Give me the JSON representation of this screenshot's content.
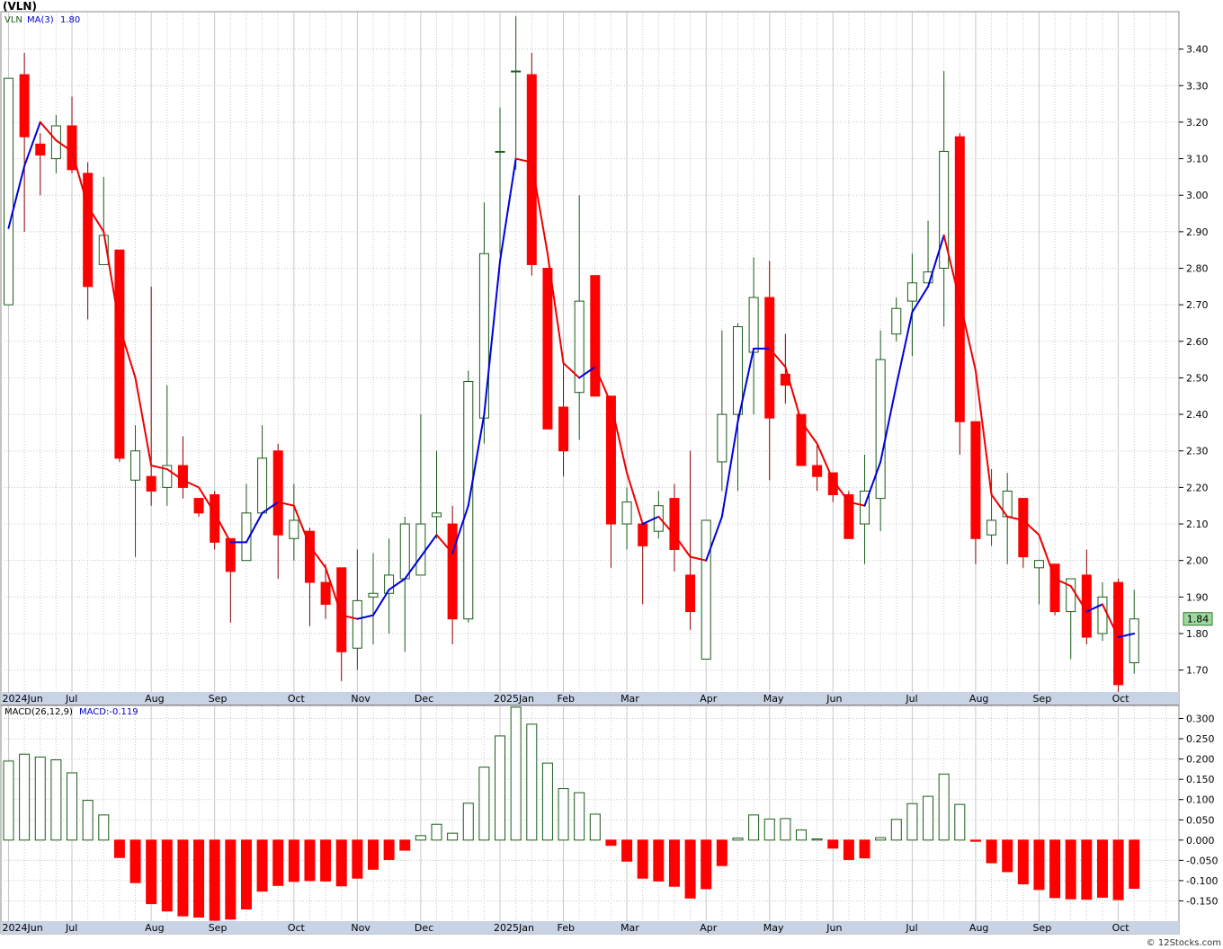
{
  "page": {
    "symbol": "(VLN)",
    "watermark": "© 12Stocks.com"
  },
  "colors": {
    "up": "#1a5c1a",
    "down": "#ff0000",
    "ma_up": "#0000dd",
    "ma_down": "#ee0000",
    "grid": "#c8c8c8",
    "axis_band": "#c8d3e6",
    "price_tag_bg": "#9fd89f"
  },
  "chart_data": [
    {
      "type": "candlestick",
      "legend": {
        "symbol": "VLN",
        "ma_label": "MA(3)",
        "ma_value": "1.80"
      },
      "ylim": [
        1.64,
        3.5
      ],
      "y_ticks": [
        1.7,
        1.8,
        1.9,
        2.0,
        2.1,
        2.2,
        2.3,
        2.4,
        2.5,
        2.6,
        2.7,
        2.8,
        2.9,
        3.0,
        3.1,
        3.2,
        3.3,
        3.4
      ],
      "y_tick_labels": [
        "1.70",
        "1.80",
        "1.90",
        "2.00",
        "2.10",
        "2.20",
        "2.30",
        "2.40",
        "2.50",
        "2.60",
        "2.70",
        "2.80",
        "2.90",
        "3.00",
        "3.10",
        "3.20",
        "3.30",
        "3.40"
      ],
      "last_price_label": "1.84",
      "last_price": 1.84,
      "x_labels": [
        {
          "label": "2024Jun",
          "week": 0
        },
        {
          "label": "Jul",
          "week": 4
        },
        {
          "label": "Aug",
          "week": 9
        },
        {
          "label": "Sep",
          "week": 13
        },
        {
          "label": "Oct",
          "week": 18
        },
        {
          "label": "Nov",
          "week": 22
        },
        {
          "label": "Dec",
          "week": 26
        },
        {
          "label": "2025Jan",
          "week": 31
        },
        {
          "label": "Feb",
          "week": 35
        },
        {
          "label": "Mar",
          "week": 39
        },
        {
          "label": "Apr",
          "week": 44
        },
        {
          "label": "May",
          "week": 48
        },
        {
          "label": "Jun",
          "week": 52
        },
        {
          "label": "Jul",
          "week": 57
        },
        {
          "label": "Aug",
          "week": 61
        },
        {
          "label": "Sep",
          "week": 65
        },
        {
          "label": "Oct",
          "week": 70
        }
      ],
      "candles": [
        {
          "o": 2.7,
          "h": 3.32,
          "l": 2.7,
          "c": 3.32
        },
        {
          "o": 3.33,
          "h": 3.39,
          "l": 2.9,
          "c": 3.16
        },
        {
          "o": 3.14,
          "h": 3.17,
          "l": 3.0,
          "c": 3.11
        },
        {
          "o": 3.1,
          "h": 3.22,
          "l": 3.06,
          "c": 3.19
        },
        {
          "o": 3.19,
          "h": 3.27,
          "l": 3.06,
          "c": 3.07
        },
        {
          "o": 3.06,
          "h": 3.09,
          "l": 2.66,
          "c": 2.75
        },
        {
          "o": 2.81,
          "h": 3.05,
          "l": 2.81,
          "c": 2.89
        },
        {
          "o": 2.85,
          "h": 2.85,
          "l": 2.27,
          "c": 2.28
        },
        {
          "o": 2.22,
          "h": 2.37,
          "l": 2.01,
          "c": 2.3
        },
        {
          "o": 2.23,
          "h": 2.75,
          "l": 2.15,
          "c": 2.19
        },
        {
          "o": 2.2,
          "h": 2.48,
          "l": 2.15,
          "c": 2.26
        },
        {
          "o": 2.26,
          "h": 2.34,
          "l": 2.17,
          "c": 2.2
        },
        {
          "o": 2.17,
          "h": 2.17,
          "l": 2.12,
          "c": 2.13
        },
        {
          "o": 2.18,
          "h": 2.19,
          "l": 2.03,
          "c": 2.05
        },
        {
          "o": 2.06,
          "h": 2.06,
          "l": 1.83,
          "c": 1.97
        },
        {
          "o": 2.0,
          "h": 2.21,
          "l": 2.0,
          "c": 2.13
        },
        {
          "o": 2.13,
          "h": 2.37,
          "l": 2.13,
          "c": 2.28
        },
        {
          "o": 2.3,
          "h": 2.32,
          "l": 1.95,
          "c": 2.07
        },
        {
          "o": 2.06,
          "h": 2.21,
          "l": 2.0,
          "c": 2.11
        },
        {
          "o": 2.08,
          "h": 2.09,
          "l": 1.82,
          "c": 1.94
        },
        {
          "o": 1.94,
          "h": 1.99,
          "l": 1.84,
          "c": 1.88
        },
        {
          "o": 1.98,
          "h": 1.98,
          "l": 1.67,
          "c": 1.75
        },
        {
          "o": 1.76,
          "h": 2.03,
          "l": 1.7,
          "c": 1.89
        },
        {
          "o": 1.9,
          "h": 2.02,
          "l": 1.77,
          "c": 1.91
        },
        {
          "o": 1.91,
          "h": 2.06,
          "l": 1.8,
          "c": 1.96
        },
        {
          "o": 1.95,
          "h": 2.12,
          "l": 1.75,
          "c": 2.1
        },
        {
          "o": 1.96,
          "h": 2.4,
          "l": 1.96,
          "c": 2.1
        },
        {
          "o": 2.12,
          "h": 2.3,
          "l": 2.06,
          "c": 2.13
        },
        {
          "o": 2.1,
          "h": 2.15,
          "l": 1.77,
          "c": 1.84
        },
        {
          "o": 1.84,
          "h": 2.52,
          "l": 1.83,
          "c": 2.49
        },
        {
          "o": 2.39,
          "h": 2.98,
          "l": 2.32,
          "c": 2.84
        },
        {
          "o": 3.12,
          "h": 3.24,
          "l": 2.84,
          "c": 3.12
        },
        {
          "o": 3.34,
          "h": 3.49,
          "l": 3.07,
          "c": 3.34
        },
        {
          "o": 3.33,
          "h": 3.39,
          "l": 2.78,
          "c": 2.81
        },
        {
          "o": 2.8,
          "h": 2.8,
          "l": 2.36,
          "c": 2.36
        },
        {
          "o": 2.42,
          "h": 2.54,
          "l": 2.23,
          "c": 2.3
        },
        {
          "o": 2.46,
          "h": 3.0,
          "l": 2.33,
          "c": 2.71
        },
        {
          "o": 2.78,
          "h": 2.78,
          "l": 2.45,
          "c": 2.45
        },
        {
          "o": 2.45,
          "h": 2.45,
          "l": 1.98,
          "c": 2.1
        },
        {
          "o": 2.1,
          "h": 2.2,
          "l": 2.03,
          "c": 2.16
        },
        {
          "o": 2.1,
          "h": 2.1,
          "l": 1.88,
          "c": 2.04
        },
        {
          "o": 2.08,
          "h": 2.19,
          "l": 2.06,
          "c": 2.15
        },
        {
          "o": 2.17,
          "h": 2.21,
          "l": 1.97,
          "c": 2.03
        },
        {
          "o": 1.96,
          "h": 2.3,
          "l": 1.81,
          "c": 1.86
        },
        {
          "o": 1.73,
          "h": 2.11,
          "l": 1.73,
          "c": 2.11
        },
        {
          "o": 2.27,
          "h": 2.63,
          "l": 2.19,
          "c": 2.4
        },
        {
          "o": 2.4,
          "h": 2.65,
          "l": 2.19,
          "c": 2.64
        },
        {
          "o": 2.57,
          "h": 2.83,
          "l": 2.4,
          "c": 2.72
        },
        {
          "o": 2.72,
          "h": 2.82,
          "l": 2.22,
          "c": 2.39
        },
        {
          "o": 2.51,
          "h": 2.62,
          "l": 2.43,
          "c": 2.48
        },
        {
          "o": 2.4,
          "h": 2.4,
          "l": 2.26,
          "c": 2.26
        },
        {
          "o": 2.26,
          "h": 2.32,
          "l": 2.19,
          "c": 2.23
        },
        {
          "o": 2.24,
          "h": 2.24,
          "l": 2.16,
          "c": 2.18
        },
        {
          "o": 2.18,
          "h": 2.19,
          "l": 2.06,
          "c": 2.06
        },
        {
          "o": 2.1,
          "h": 2.29,
          "l": 1.99,
          "c": 2.19
        },
        {
          "o": 2.17,
          "h": 2.63,
          "l": 2.08,
          "c": 2.55
        },
        {
          "o": 2.62,
          "h": 2.72,
          "l": 2.6,
          "c": 2.69
        },
        {
          "o": 2.71,
          "h": 2.84,
          "l": 2.56,
          "c": 2.76
        },
        {
          "o": 2.76,
          "h": 2.93,
          "l": 2.76,
          "c": 2.79
        },
        {
          "o": 2.8,
          "h": 3.34,
          "l": 2.64,
          "c": 3.12
        },
        {
          "o": 3.16,
          "h": 3.17,
          "l": 2.29,
          "c": 2.38
        },
        {
          "o": 2.38,
          "h": 2.38,
          "l": 1.99,
          "c": 2.06
        },
        {
          "o": 2.07,
          "h": 2.25,
          "l": 2.04,
          "c": 2.11
        },
        {
          "o": 2.12,
          "h": 2.24,
          "l": 1.99,
          "c": 2.19
        },
        {
          "o": 2.17,
          "h": 2.17,
          "l": 1.98,
          "c": 2.01
        },
        {
          "o": 1.98,
          "h": 2.0,
          "l": 1.88,
          "c": 2.0
        },
        {
          "o": 1.99,
          "h": 1.99,
          "l": 1.85,
          "c": 1.86
        },
        {
          "o": 1.86,
          "h": 1.95,
          "l": 1.73,
          "c": 1.95
        },
        {
          "o": 1.96,
          "h": 2.03,
          "l": 1.77,
          "c": 1.79
        },
        {
          "o": 1.8,
          "h": 1.94,
          "l": 1.78,
          "c": 1.9
        },
        {
          "o": 1.94,
          "h": 1.95,
          "l": 1.64,
          "c": 1.66
        },
        {
          "o": 1.72,
          "h": 1.92,
          "l": 1.69,
          "c": 1.84
        }
      ],
      "ma": [
        2.91,
        3.08,
        3.2,
        3.15,
        3.12,
        2.97,
        2.9,
        2.64,
        2.5,
        2.26,
        2.25,
        2.22,
        2.2,
        2.13,
        2.05,
        2.05,
        2.13,
        2.16,
        2.15,
        2.04,
        1.98,
        1.85,
        1.84,
        1.85,
        1.92,
        1.95,
        2.01,
        2.07,
        2.02,
        2.15,
        2.4,
        2.82,
        3.1,
        3.09,
        2.84,
        2.54,
        2.5,
        2.53,
        2.43,
        2.24,
        2.1,
        2.12,
        2.07,
        2.01,
        2.0,
        2.12,
        2.38,
        2.58,
        2.58,
        2.53,
        2.38,
        2.32,
        2.22,
        2.16,
        2.15,
        2.27,
        2.48,
        2.68,
        2.75,
        2.89,
        2.71,
        2.52,
        2.18,
        2.12,
        2.11,
        2.07,
        1.95,
        1.93,
        1.86,
        1.88,
        1.79,
        1.8
      ]
    },
    {
      "type": "bar",
      "title": "MACD(26,12,9)",
      "value_label": "MACD:-0.119",
      "ylim": [
        -0.2,
        0.33
      ],
      "y_ticks": [
        -0.15,
        -0.1,
        -0.05,
        0.0,
        0.05,
        0.1,
        0.15,
        0.2,
        0.25,
        0.3
      ],
      "y_tick_labels": [
        "-0.150",
        "-0.100",
        "-0.050",
        "0.000",
        "0.050",
        "0.100",
        "0.150",
        "0.200",
        "0.250",
        "0.300"
      ],
      "values": [
        0.195,
        0.212,
        0.205,
        0.198,
        0.166,
        0.098,
        0.062,
        -0.043,
        -0.105,
        -0.157,
        -0.175,
        -0.187,
        -0.19,
        -0.198,
        -0.195,
        -0.17,
        -0.126,
        -0.112,
        -0.102,
        -0.1,
        -0.101,
        -0.113,
        -0.094,
        -0.072,
        -0.048,
        -0.025,
        0.011,
        0.039,
        0.017,
        0.091,
        0.18,
        0.257,
        0.328,
        0.286,
        0.19,
        0.127,
        0.117,
        0.064,
        -0.013,
        -0.052,
        -0.094,
        -0.101,
        -0.114,
        -0.143,
        -0.12,
        -0.063,
        0.005,
        0.062,
        0.052,
        0.053,
        0.025,
        0.003,
        -0.02,
        -0.048,
        -0.044,
        0.006,
        0.051,
        0.09,
        0.108,
        0.163,
        0.088,
        -0.003,
        -0.056,
        -0.078,
        -0.108,
        -0.122,
        -0.142,
        -0.145,
        -0.146,
        -0.141,
        -0.147,
        -0.119
      ]
    }
  ]
}
